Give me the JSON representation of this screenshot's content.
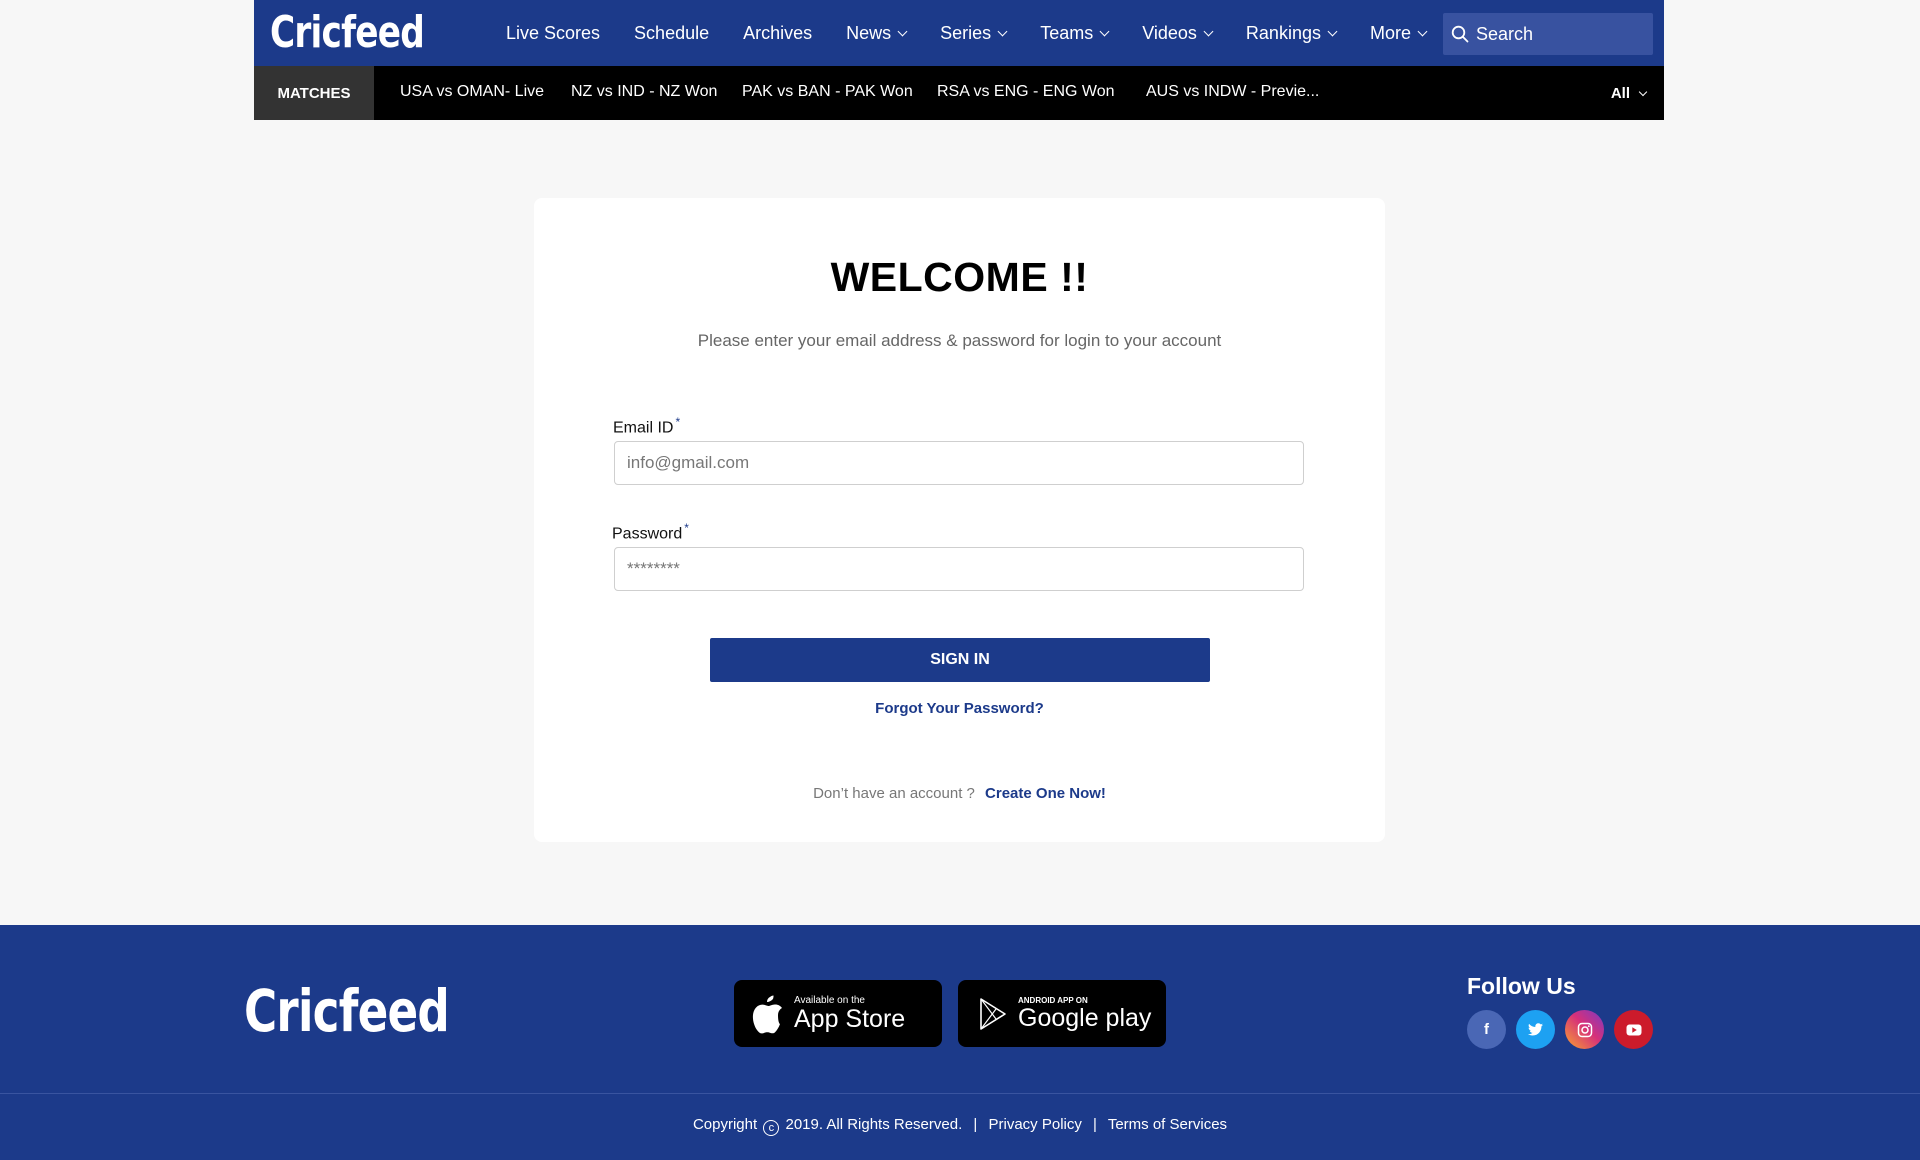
{
  "header": {
    "logo": "Cricfeed",
    "nav": [
      {
        "label": "Live Scores",
        "dropdown": false
      },
      {
        "label": "Schedule",
        "dropdown": false
      },
      {
        "label": "Archives",
        "dropdown": false
      },
      {
        "label": "News",
        "dropdown": true
      },
      {
        "label": "Series",
        "dropdown": true
      },
      {
        "label": "Teams",
        "dropdown": true
      },
      {
        "label": "Videos",
        "dropdown": true
      },
      {
        "label": "Rankings",
        "dropdown": true
      },
      {
        "label": "More",
        "dropdown": true
      }
    ],
    "search_placeholder": "Search"
  },
  "matchbar": {
    "label": "MATCHES",
    "matches": [
      "USA vs OMAN- Live",
      "NZ vs IND - NZ Won",
      "PAK vs BAN - PAK Won",
      "RSA vs  ENG - ENG Won",
      "AUS vs INDW - Previe..."
    ],
    "filter": "All"
  },
  "login": {
    "title": "WELCOME !!",
    "subtitle": "Please enter your email address &  password for login to your account",
    "email_label": "Email ID",
    "email_placeholder": "info@gmail.com",
    "password_label": "Password",
    "password_placeholder": "********",
    "required_mark": "*",
    "signin_label": "SIGN IN",
    "forgot_label": "Forgot Your Password?",
    "no_account_text": "Don’t have an account ?",
    "create_label": "Create One Now!"
  },
  "footer": {
    "logo": "Cricfeed",
    "app_store": {
      "small": "Available on the",
      "big": "App Store"
    },
    "google_play": {
      "small": "ANDROID APP ON",
      "big": "Google play"
    },
    "follow_label": "Follow Us",
    "socials": [
      {
        "icon": "facebook-icon",
        "glyph": "f",
        "color": "#4a67b5"
      },
      {
        "icon": "twitter-icon",
        "glyph": "t",
        "color": "#1da1f2"
      },
      {
        "icon": "instagram-icon",
        "glyph": "◎",
        "color": "#d6307a"
      },
      {
        "icon": "youtube-icon",
        "glyph": "▶",
        "color": "#cc1b2b"
      }
    ],
    "copyright_prefix": "Copyright",
    "copyright_symbol": "c",
    "copyright_suffix": "2019. All Rights Reserved.",
    "privacy_label": "Privacy Policy",
    "terms_label": "Terms of Services",
    "separator": "|"
  }
}
